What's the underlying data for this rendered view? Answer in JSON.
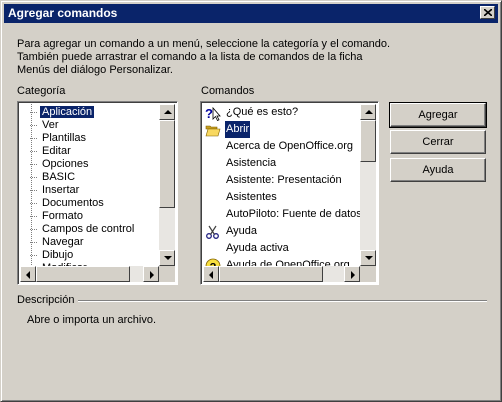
{
  "window": {
    "title": "Agregar comandos"
  },
  "intro_text": "Para agregar un comando a un menú, seleccione la categoría y el comando.\nTambién puede arrastrar el comando a la lista de comandos de la ficha\nMenús del diálogo Personalizar.",
  "category": {
    "label": "Categoría",
    "items": [
      "Aplicación",
      "Ver",
      "Plantillas",
      "Editar",
      "Opciones",
      "BASIC",
      "Insertar",
      "Documentos",
      "Formato",
      "Campos de control",
      "Navegar",
      "Dibujo",
      "Modificar"
    ],
    "selected": "Aplicación"
  },
  "commands": {
    "label": "Comandos",
    "items": [
      {
        "label": "¿Qué es esto?",
        "icon": "whats-this-icon"
      },
      {
        "label": "Abrir",
        "icon": "open-folder-icon"
      },
      {
        "label": "Acerca de OpenOffice.org",
        "icon": ""
      },
      {
        "label": "Asistencia",
        "icon": ""
      },
      {
        "label": "Asistente: Presentación",
        "icon": ""
      },
      {
        "label": "Asistentes",
        "icon": ""
      },
      {
        "label": "AutoPiloto: Fuente de datos de",
        "icon": ""
      },
      {
        "label": "Ayuda",
        "icon": "scissors-icon"
      },
      {
        "label": "Ayuda activa",
        "icon": ""
      },
      {
        "label": "Ayuda de OpenOffice.org",
        "icon": "help-icon"
      }
    ],
    "selected": "Abrir"
  },
  "buttons": {
    "add": "Agregar",
    "close": "Cerrar",
    "help": "Ayuda"
  },
  "description": {
    "label": "Descripción",
    "text": "Abre o importa un archivo."
  },
  "colors": {
    "titlebar": "#0a246a",
    "selection": "#0a246a",
    "face": "#d4d0c8"
  }
}
